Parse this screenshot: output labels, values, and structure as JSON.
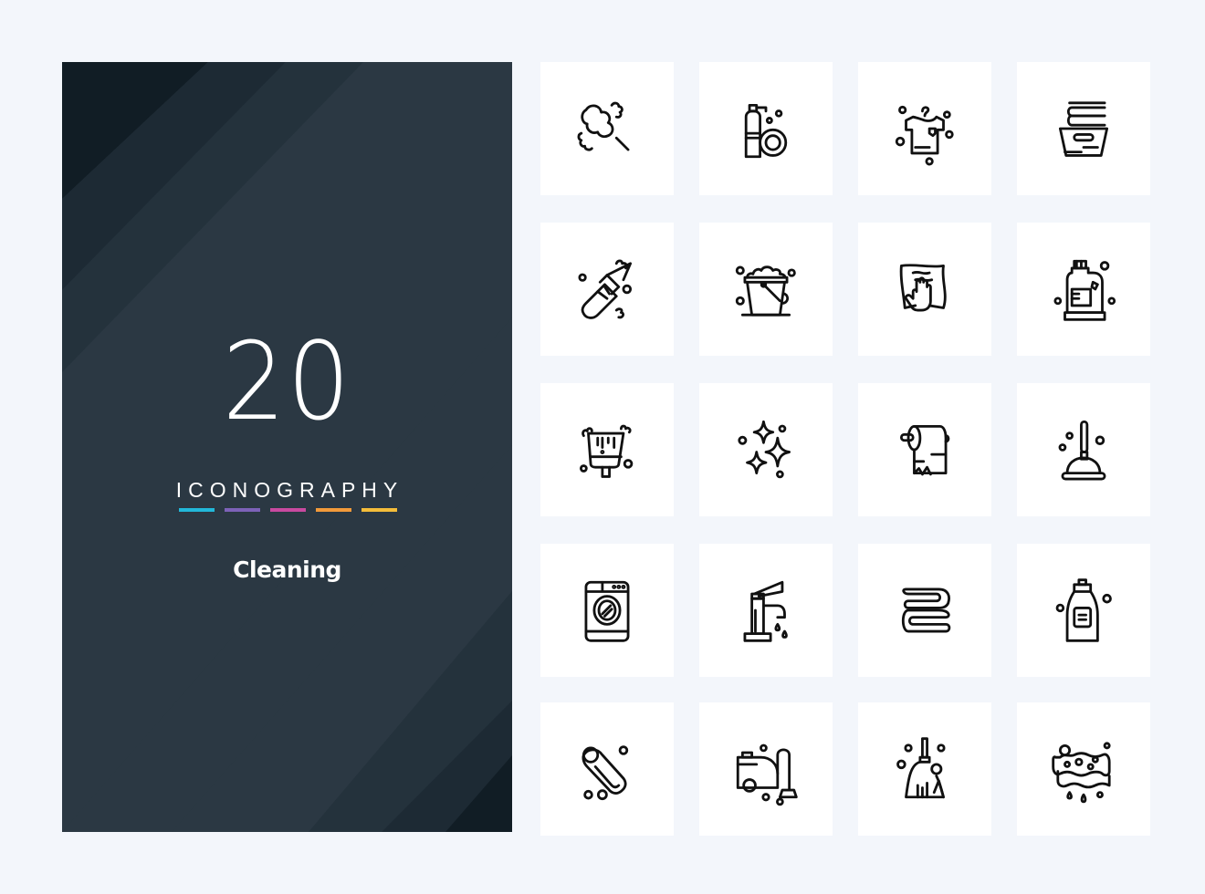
{
  "cover": {
    "count": "20",
    "tagline": "ICONOGRAPHY",
    "title": "Cleaning",
    "background_color": "#2b3843",
    "accent_bars": [
      "#22b8d9",
      "#7d62b8",
      "#c94aa0",
      "#f29a3a",
      "#f4bd3a"
    ]
  },
  "icons": [
    {
      "name": "feather-duster"
    },
    {
      "name": "spray-and-plate"
    },
    {
      "name": "shirt-on-hanger"
    },
    {
      "name": "laundry-basket-towels"
    },
    {
      "name": "scrub-glove"
    },
    {
      "name": "bucket-with-foam"
    },
    {
      "name": "hand-wiping-cloth"
    },
    {
      "name": "detergent-bottle"
    },
    {
      "name": "dustpan-brush"
    },
    {
      "name": "sparkles"
    },
    {
      "name": "toilet-paper-roll"
    },
    {
      "name": "plunger"
    },
    {
      "name": "washing-machine"
    },
    {
      "name": "faucet-dripping"
    },
    {
      "name": "folded-towel"
    },
    {
      "name": "soap-bottle"
    },
    {
      "name": "soap-bar"
    },
    {
      "name": "vacuum-cleaner"
    },
    {
      "name": "broom"
    },
    {
      "name": "sponge"
    }
  ]
}
